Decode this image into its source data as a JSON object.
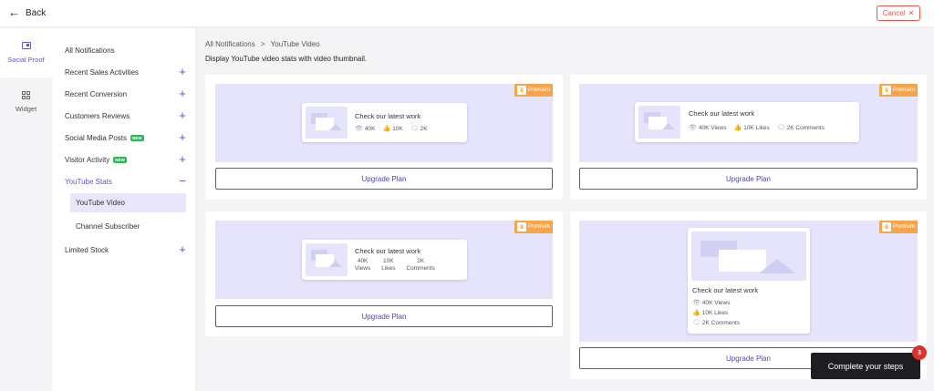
{
  "topbar": {
    "back_label": "Back",
    "cancel_label": "Cancel"
  },
  "rail": [
    {
      "label": "Social Proof",
      "icon": "social-proof-icon"
    },
    {
      "label": "Widget",
      "icon": "widget-grid-icon"
    }
  ],
  "subnav": {
    "items": [
      {
        "label": "All Notifications"
      },
      {
        "label": "Recent Sales Activities"
      },
      {
        "label": "Recent Conversion"
      },
      {
        "label": "Customers Reviews"
      },
      {
        "label": "Social Media Posts",
        "badge": "NEW"
      },
      {
        "label": "Visitor Activity",
        "badge": "NEW"
      },
      {
        "label": "YouTube Stats"
      },
      {
        "label": "Limited Stock"
      }
    ],
    "sub_items": [
      {
        "label": "YouTube Video"
      },
      {
        "label": "Channel Subscriber"
      }
    ]
  },
  "breadcrumb": {
    "root": "All Notifications",
    "separator": ">",
    "current": "YouTube Video"
  },
  "description": "Display YouTube video stats with video thumbnail.",
  "cards": [
    {
      "premium": "Premium",
      "title": "Check our latest work",
      "stats": [
        "40K",
        "10K",
        "2K"
      ],
      "button": "Upgrade Plan"
    },
    {
      "premium": "Premium",
      "title": "Check our latest work",
      "stats": [
        "40K Views",
        "10K Likes",
        "2K Comments"
      ],
      "button": "Upgrade Plan"
    },
    {
      "premium": "Premium",
      "title": "Check our latest work",
      "stats": [
        [
          "40K",
          "Views"
        ],
        [
          "10K",
          "Likes"
        ],
        [
          "2K",
          "Comments"
        ]
      ],
      "button": "Upgrade Plan"
    },
    {
      "premium": "Premium",
      "title": "Check our latest work",
      "stats": [
        "40K Views",
        "10K Likes",
        "2K Comments"
      ],
      "button": "Upgrade Plan"
    }
  ],
  "toast": {
    "label": "Complete your steps",
    "count": "3"
  },
  "colors": {
    "accent": "#5b56d6",
    "premium": "#f6a54a",
    "preview_bg": "#e5e4fb",
    "danger": "#e2574c",
    "new_badge": "#2fb65a"
  }
}
